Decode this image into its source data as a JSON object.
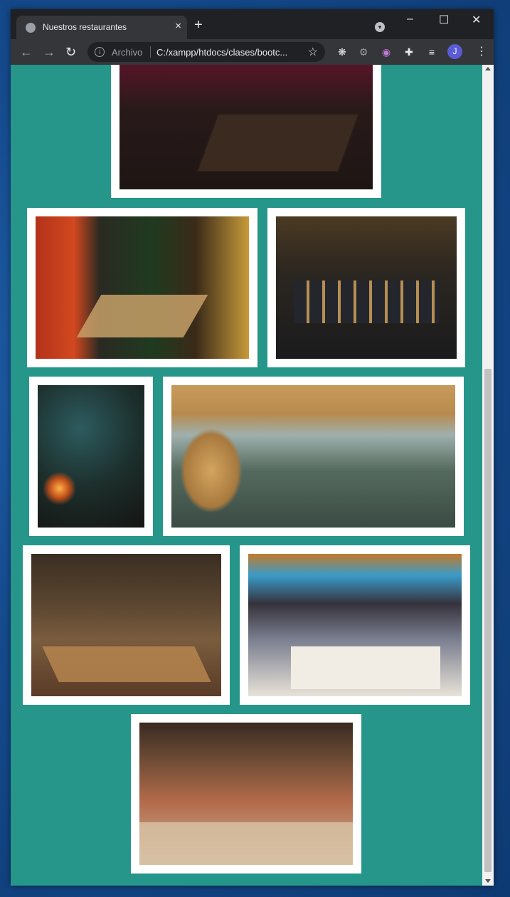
{
  "browser": {
    "tab_title": "Nuestros restaurantes",
    "new_tab_symbol": "+",
    "tab_close_symbol": "×",
    "address_scheme_label": "Archivo",
    "address_url": "C:/xampp/htdocs/clases/bootc...",
    "profile_initial": "J",
    "window_controls": [
      "–",
      "☐",
      "✕"
    ]
  },
  "icons": {
    "tab_favicon": "globe-icon",
    "info": "info-icon",
    "bookmark": "star-icon",
    "extensions": [
      "sheep-extension-icon",
      "gear-extension-icon",
      "broadcast-extension-icon",
      "puzzle-extension-icon",
      "media-queue-icon"
    ],
    "menu": "kebab-menu-icon"
  },
  "page": {
    "background_color": "#26958a",
    "gallery": [
      {
        "name": "restaurant-photo-1"
      },
      {
        "name": "restaurant-photo-2"
      },
      {
        "name": "restaurant-photo-3"
      },
      {
        "name": "restaurant-photo-4"
      },
      {
        "name": "restaurant-photo-5"
      },
      {
        "name": "restaurant-photo-6"
      },
      {
        "name": "restaurant-photo-7"
      },
      {
        "name": "restaurant-photo-8"
      }
    ]
  }
}
